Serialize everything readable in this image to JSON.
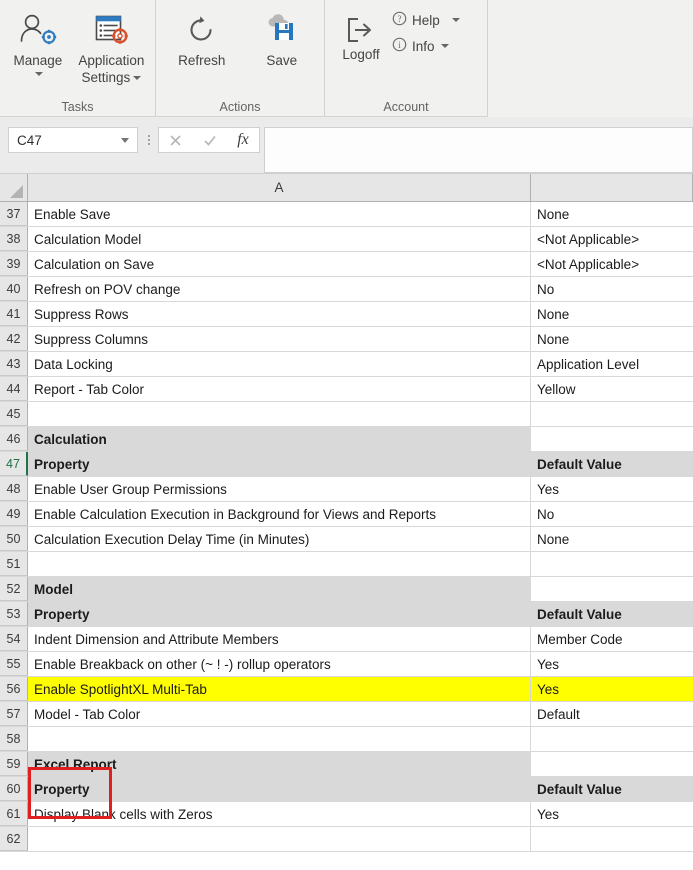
{
  "ribbon": {
    "groups": [
      {
        "title": "Tasks",
        "buttons": [
          {
            "label_line1": "Manage",
            "label_line2": "",
            "icon": "person-gear-icon",
            "has_caret": true
          },
          {
            "label_line1": "Application",
            "label_line2": "Settings",
            "icon": "list-gear-icon",
            "has_caret": true
          }
        ]
      },
      {
        "title": "Actions",
        "buttons": [
          {
            "label_line1": "Refresh",
            "label_line2": "",
            "icon": "refresh-icon",
            "has_caret": false
          },
          {
            "label_line1": "Save",
            "label_line2": "",
            "icon": "cloud-save-icon",
            "has_caret": false
          }
        ]
      },
      {
        "title": "Account",
        "buttons": [
          {
            "label_line1": "Logoff",
            "label_line2": "",
            "icon": "logoff-icon",
            "has_caret": false
          }
        ],
        "small_buttons": [
          {
            "label": "Help",
            "icon": "help-circle-icon",
            "has_caret": true
          },
          {
            "label": "Info",
            "icon": "info-circle-icon",
            "has_caret": true
          }
        ]
      }
    ]
  },
  "formula_bar": {
    "name_box_value": "C47",
    "name_box_placeholder": "Name Box",
    "cancel_icon": "cancel-x-icon",
    "enter_icon": "check-icon",
    "function_icon": "fx-icon",
    "formula_value": "",
    "formula_placeholder": ""
  },
  "grid": {
    "columns": [
      {
        "id": "A",
        "label": "A"
      },
      {
        "id": "B",
        "label": ""
      }
    ],
    "selected_cell": "C47",
    "selected_row": 47,
    "colors": {
      "section_header_fill": "#D9D9D9",
      "highlight_fill": "#FFFF00",
      "selection_accent": "#217346",
      "annotation_border": "#E02020"
    },
    "annotation": {
      "shape": "rectangle",
      "color": "#E02020",
      "covers_rows": [
        52,
        53
      ],
      "covers_text": [
        "Model",
        "Property"
      ]
    },
    "rows": [
      {
        "n": 37,
        "a": "Enable Save",
        "b": "None",
        "style": "normal"
      },
      {
        "n": 38,
        "a": "Calculation Model",
        "b": "<Not Applicable>",
        "style": "normal"
      },
      {
        "n": 39,
        "a": "Calculation on Save",
        "b": "<Not Applicable>",
        "style": "normal"
      },
      {
        "n": 40,
        "a": "Refresh on POV change",
        "b": "No",
        "style": "normal"
      },
      {
        "n": 41,
        "a": "Suppress Rows",
        "b": "None",
        "style": "normal"
      },
      {
        "n": 42,
        "a": "Suppress Columns",
        "b": "None",
        "style": "normal"
      },
      {
        "n": 43,
        "a": "Data Locking",
        "b": "Application Level",
        "style": "normal"
      },
      {
        "n": 44,
        "a": "Report - Tab Color",
        "b": "Yellow",
        "style": "normal"
      },
      {
        "n": 45,
        "a": "",
        "b": "",
        "style": "normal"
      },
      {
        "n": 46,
        "a": "Calculation",
        "b": "",
        "style": "section"
      },
      {
        "n": 47,
        "a": "Property",
        "b": "Default Value",
        "style": "header",
        "selected": true
      },
      {
        "n": 48,
        "a": "Enable User Group Permissions",
        "b": "Yes",
        "style": "normal"
      },
      {
        "n": 49,
        "a": "Enable Calculation Execution in Background for Views and Reports",
        "b": "No",
        "style": "normal"
      },
      {
        "n": 50,
        "a": "Calculation Execution Delay Time (in Minutes)",
        "b": "None",
        "style": "normal"
      },
      {
        "n": 51,
        "a": "",
        "b": "",
        "style": "normal"
      },
      {
        "n": 52,
        "a": "Model",
        "b": "",
        "style": "section"
      },
      {
        "n": 53,
        "a": "Property",
        "b": "Default Value",
        "style": "header"
      },
      {
        "n": 54,
        "a": "Indent Dimension and Attribute Members",
        "b": "Member Code",
        "style": "normal"
      },
      {
        "n": 55,
        "a": "Enable Breakback on other (~ ! -) rollup operators",
        "b": "Yes",
        "style": "normal"
      },
      {
        "n": 56,
        "a": "Enable SpotlightXL Multi-Tab",
        "b": "Yes",
        "style": "highlight"
      },
      {
        "n": 57,
        "a": "Model - Tab Color",
        "b": "Default",
        "style": "normal"
      },
      {
        "n": 58,
        "a": "",
        "b": "",
        "style": "normal"
      },
      {
        "n": 59,
        "a": "Excel Report",
        "b": "",
        "style": "section"
      },
      {
        "n": 60,
        "a": "Property",
        "b": "Default Value",
        "style": "header"
      },
      {
        "n": 61,
        "a": "Display Blank cells with Zeros",
        "b": "Yes",
        "style": "normal"
      },
      {
        "n": 62,
        "a": "",
        "b": "",
        "style": "normal"
      }
    ]
  }
}
